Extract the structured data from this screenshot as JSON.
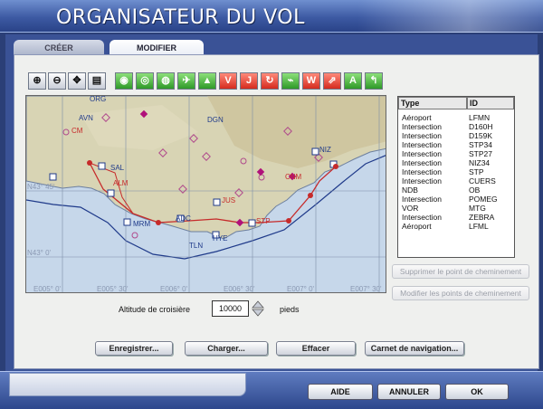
{
  "window": {
    "title": "ORGANISATEUR DU VOL"
  },
  "tabs": [
    {
      "label": "CRÉER",
      "active": false
    },
    {
      "label": "MODIFIER",
      "active": true
    }
  ],
  "toolbar": {
    "icons": [
      "zoom-in-icon",
      "zoom-out-icon",
      "center-icon",
      "print-icon",
      "vor-filter-icon",
      "ndb-filter-icon",
      "ils-filter-icon",
      "airport-filter-icon",
      "intersection-filter-icon",
      "airway-v-icon",
      "airway-j-icon",
      "rotate-icon",
      "airway-icon",
      "weather-icon",
      "route-icon",
      "terrain-icon",
      "text-icon"
    ],
    "letters": {
      "v": "V",
      "j": "J",
      "w": "W"
    }
  },
  "map": {
    "labels": [
      "ORG",
      "AVN",
      "CM",
      "DGN",
      "NIZ",
      "SAL",
      "ALM",
      "MRM",
      "ADC",
      "STP",
      "HYE",
      "TLN",
      "JUS",
      "CNM"
    ],
    "grid_labels": [
      "N43° 45'",
      "N43° 0'",
      "E005° 0'",
      "E005° 30'",
      "E006° 0'",
      "E006° 30'",
      "E007° 0'",
      "E007° 30'"
    ],
    "colors": {
      "sea": "#c6d7ea",
      "land": "#d8d4b4",
      "route": "#c62a2a",
      "border": "#1f3a8a"
    }
  },
  "waypoints": {
    "header_type": "Type",
    "header_id": "ID",
    "rows": [
      {
        "type": "Aéroport",
        "id": "LFMN"
      },
      {
        "type": "Intersection",
        "id": "D160H"
      },
      {
        "type": "Intersection",
        "id": "D159K"
      },
      {
        "type": "Intersection",
        "id": "STP34"
      },
      {
        "type": "Intersection",
        "id": "STP27"
      },
      {
        "type": "Intersection",
        "id": "NIZ34"
      },
      {
        "type": "Intersection",
        "id": "STP"
      },
      {
        "type": "Intersection",
        "id": "CUERS"
      },
      {
        "type": "NDB",
        "id": "OB"
      },
      {
        "type": "Intersection",
        "id": "POMEG"
      },
      {
        "type": "VOR",
        "id": "MTG"
      },
      {
        "type": "Intersection",
        "id": "ZEBRA"
      },
      {
        "type": "Aéroport",
        "id": "LFML"
      }
    ]
  },
  "side_buttons": {
    "delete": "Supprimer le point de cheminement",
    "modify": "Modifier les points de cheminement"
  },
  "altitude": {
    "label": "Altitude de croisière",
    "value": "10000",
    "unit": "pieds"
  },
  "actions": {
    "save": "Enregistrer...",
    "load": "Charger...",
    "clear": "Effacer",
    "logbook": "Carnet de navigation..."
  },
  "footer": {
    "help": "AIDE",
    "cancel": "ANNULER",
    "ok": "OK"
  }
}
